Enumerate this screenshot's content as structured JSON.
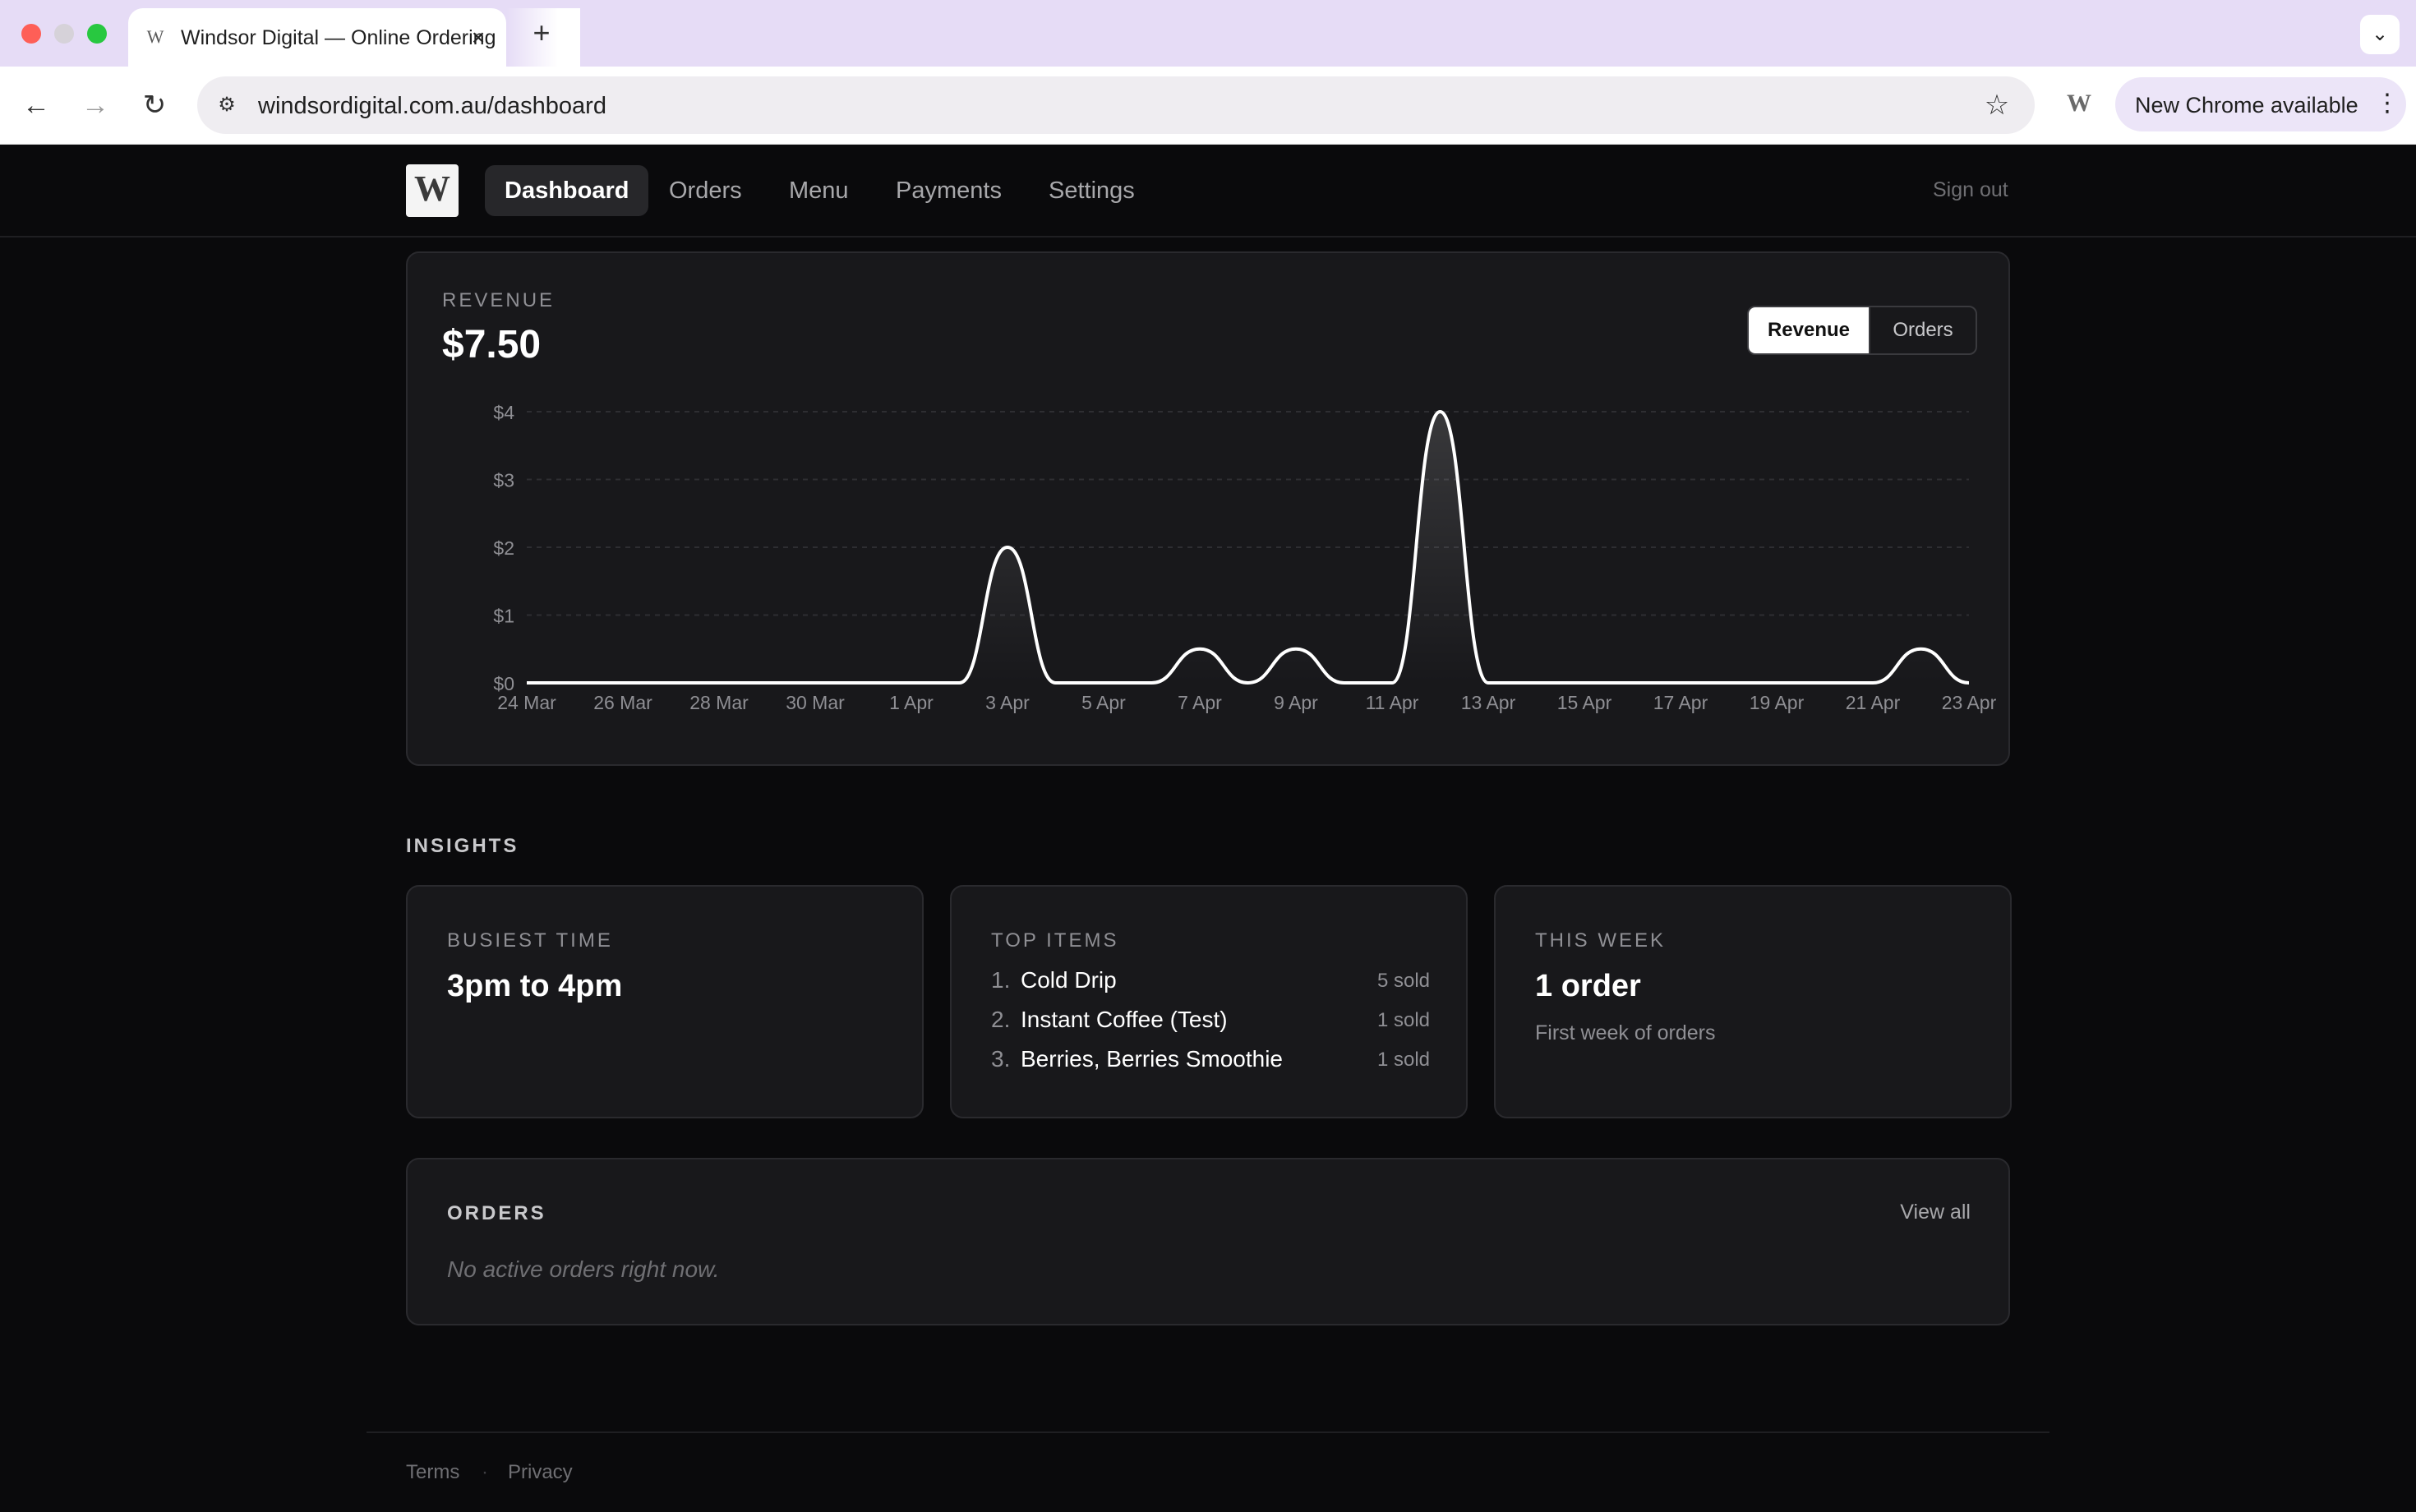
{
  "browser": {
    "tab_title": "Windsor Digital — Online Ordering",
    "tab_favicon": "W",
    "url": "windsordigital.com.au/dashboard",
    "update_label": "New Chrome available",
    "extension_letter": "W",
    "icons": {
      "close": "×",
      "new_tab": "+",
      "tab_menu": "⌄",
      "back": "←",
      "forward": "→",
      "reload": "↻",
      "site_info": "⚙",
      "star": "☆",
      "kebab": "⋮"
    }
  },
  "header": {
    "logo_letter": "W",
    "nav": [
      {
        "label": "Dashboard",
        "active": true
      },
      {
        "label": "Orders",
        "active": false
      },
      {
        "label": "Menu",
        "active": false
      },
      {
        "label": "Payments",
        "active": false
      },
      {
        "label": "Settings",
        "active": false
      }
    ],
    "sign_out": "Sign out"
  },
  "revenue": {
    "eyebrow": "REVENUE",
    "total": "$7.50",
    "toggle": {
      "revenue": "Revenue",
      "orders": "Orders",
      "selected": "Revenue"
    }
  },
  "chart_data": {
    "type": "line",
    "title": "",
    "xlabel": "",
    "ylabel": "",
    "x": [
      "24 Mar",
      "25 Mar",
      "26 Mar",
      "27 Mar",
      "28 Mar",
      "29 Mar",
      "30 Mar",
      "31 Mar",
      "1 Apr",
      "2 Apr",
      "3 Apr",
      "4 Apr",
      "5 Apr",
      "6 Apr",
      "7 Apr",
      "8 Apr",
      "9 Apr",
      "10 Apr",
      "11 Apr",
      "12 Apr",
      "13 Apr",
      "14 Apr",
      "15 Apr",
      "16 Apr",
      "17 Apr",
      "18 Apr",
      "19 Apr",
      "20 Apr",
      "21 Apr",
      "22 Apr",
      "23 Apr"
    ],
    "x_tick_labels": [
      "24 Mar",
      "26 Mar",
      "28 Mar",
      "30 Mar",
      "1 Apr",
      "3 Apr",
      "5 Apr",
      "7 Apr",
      "9 Apr",
      "11 Apr",
      "13 Apr",
      "15 Apr",
      "17 Apr",
      "19 Apr",
      "21 Apr",
      "23 Apr"
    ],
    "series": [
      {
        "values": [
          0,
          0,
          0,
          0,
          0,
          0,
          0,
          0,
          0,
          0,
          2,
          0,
          0,
          0,
          0.5,
          0,
          0.5,
          0,
          0,
          4,
          0,
          0,
          0,
          0,
          0,
          0,
          0,
          0,
          0,
          0.5,
          0
        ]
      }
    ],
    "y_ticks": [
      "$0",
      "$1",
      "$2",
      "$3",
      "$4"
    ],
    "ylim": [
      0,
      4
    ],
    "grid": true,
    "line_color": "#ffffff",
    "fill": "area-gradient"
  },
  "insights": {
    "heading": "INSIGHTS",
    "busiest": {
      "eyebrow": "BUSIEST TIME",
      "value": "3pm to 4pm"
    },
    "top_items": {
      "eyebrow": "TOP ITEMS",
      "items": [
        {
          "rank": "1.",
          "name": "Cold Drip",
          "sold": "5 sold"
        },
        {
          "rank": "2.",
          "name": "Instant Coffee (Test)",
          "sold": "1 sold"
        },
        {
          "rank": "3.",
          "name": "Berries, Berries Smoothie",
          "sold": "1 sold"
        }
      ]
    },
    "this_week": {
      "eyebrow": "THIS WEEK",
      "value": "1 order",
      "sub": "First week of orders"
    }
  },
  "orders": {
    "eyebrow": "ORDERS",
    "view_all": "View all",
    "empty": "No active orders right now."
  },
  "footer": {
    "terms": "Terms",
    "separator": "·",
    "privacy": "Privacy"
  },
  "colors": {
    "background": "#0a0a0c",
    "card": "#18181b",
    "card_border": "#2a2a2e",
    "tabstrip": "#e6dcf6"
  }
}
